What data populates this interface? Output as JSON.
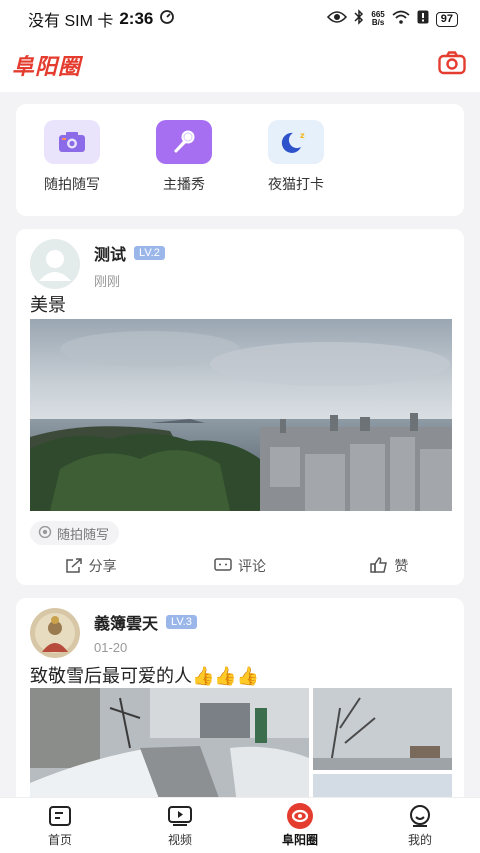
{
  "status_bar": {
    "carrier": "没有 SIM 卡",
    "time": "2:36",
    "net_speed_value": "665",
    "net_speed_unit": "B/s",
    "battery": "97"
  },
  "header": {
    "logo": "阜阳圈",
    "camera_icon": "camera-icon"
  },
  "quick_actions": [
    {
      "label": "随拍随写",
      "icon": "camera-icon",
      "color": "#e9e4fb"
    },
    {
      "label": "主播秀",
      "icon": "microphone-icon",
      "color": "#a66ff2"
    },
    {
      "label": "夜猫打卡",
      "icon": "moon-icon",
      "color": "#e6f0fb"
    }
  ],
  "posts": [
    {
      "username": "测试",
      "level": "LV.2",
      "time": "刚刚",
      "text": "美景",
      "topic": "随拍随写",
      "actions": {
        "share": "分享",
        "comment": "评论",
        "like": "赞"
      }
    },
    {
      "username": "義簿雲天",
      "level": "LV.3",
      "time": "01-20",
      "text": "致敬雪后最可爱的人👍👍👍"
    }
  ],
  "bottom_nav": [
    {
      "label": "首页",
      "icon": "home-icon"
    },
    {
      "label": "视频",
      "icon": "video-icon"
    },
    {
      "label": "阜阳圈",
      "icon": "circle-icon",
      "active": true
    },
    {
      "label": "我的",
      "icon": "profile-icon"
    }
  ],
  "colors": {
    "brand": "#e43d2f",
    "level_badge": "#9bb7ea"
  }
}
